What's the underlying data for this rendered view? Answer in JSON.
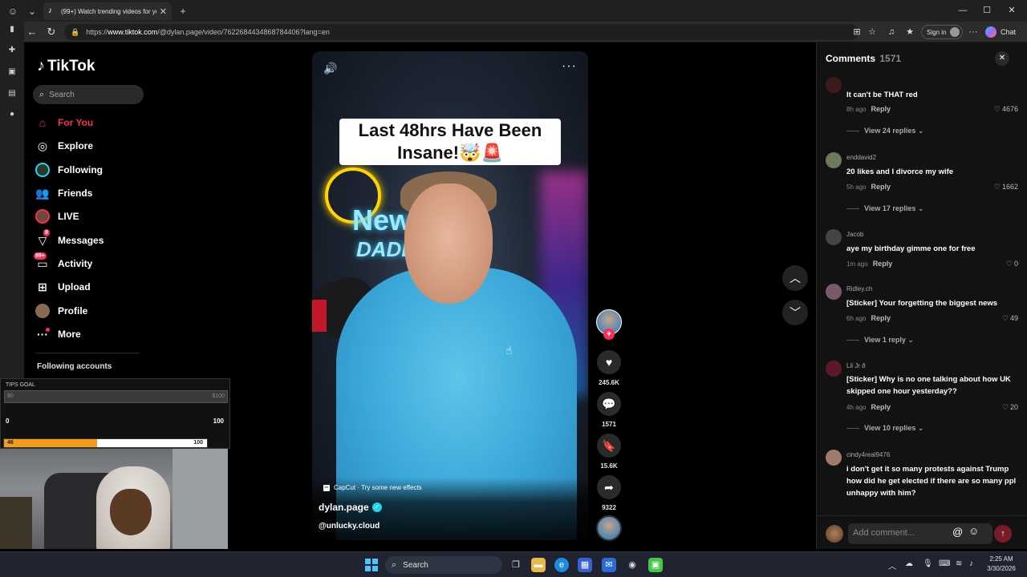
{
  "browser": {
    "tab_title": "(99+) Watch trending videos for yo",
    "url_prefix": "https://",
    "url_host": "www.tiktok.com",
    "url_path": "/@dylan.page/video/7622684434868784406?lang=en",
    "signin_label": "Sign in",
    "chat_label": "Chat"
  },
  "tiktok": {
    "logo_text": "TikTok",
    "search_placeholder": "Search",
    "nav": {
      "for_you": "For You",
      "explore": "Explore",
      "following": "Following",
      "friends": "Friends",
      "live": "LIVE",
      "messages": "Messages",
      "messages_badge": "9",
      "activity": "Activity",
      "activity_badge": "99+",
      "upload": "Upload",
      "profile": "Profile",
      "more": "More"
    },
    "following_accounts": "Following accounts"
  },
  "overlay": {
    "tips_goal": "TIPS GOAL",
    "goal_left": "$0",
    "goal_right": "$100",
    "scale_left": "0",
    "scale_right": "100",
    "progress_left": "46",
    "progress_right": "100",
    "progress_value": 46
  },
  "video": {
    "caption": "Last 48hrs Have Been Insane!🤯🚨",
    "neon_line1": "News",
    "neon_line2": "DADDY",
    "capcut": "CapCut · Try some new effects",
    "author": "dylan.page",
    "mention": "@unlucky.cloud",
    "likes": "245.6K",
    "comments": "1571",
    "saves": "15.6K",
    "shares": "9322"
  },
  "comments": {
    "title": "Comments",
    "count": "1571",
    "placeholder": "Add comment...",
    "reply_label": "Reply",
    "items": [
      {
        "user": "",
        "text": "It can't be THAT red",
        "time": "8h ago",
        "likes": "4676",
        "replies": "View 24 replies"
      },
      {
        "user": "enddavid2",
        "text": "20 likes and I divorce my wife",
        "time": "5h ago",
        "likes": "1662",
        "replies": "View 17 replies"
      },
      {
        "user": "Jacob",
        "text": "aye my birthday gimme one for free",
        "time": "1m ago",
        "likes": "0",
        "replies": ""
      },
      {
        "user": "Ridley.ch",
        "text": "[Sticker] Your forgetting the biggest news",
        "time": "6h ago",
        "likes": "49",
        "replies": "View 1 reply"
      },
      {
        "user": "Lil Jr ð",
        "text": "[Sticker] Why is no one talking about how UK skipped one hour yesterday??",
        "time": "4h ago",
        "likes": "20",
        "replies": "View 10 replies"
      },
      {
        "user": "cindy4real9476",
        "text": "i don't get it so many protests against Trump how did he get elected if there are so many ppl unhappy with him?",
        "time": "",
        "likes": "",
        "replies": ""
      }
    ]
  },
  "taskbar": {
    "search_label": "Search",
    "time": "2:25 AM",
    "date": "3/30/2026"
  },
  "colors": {
    "accent": "#fe2c55",
    "verify": "#20d5ec",
    "progress": "#f39c1d"
  }
}
